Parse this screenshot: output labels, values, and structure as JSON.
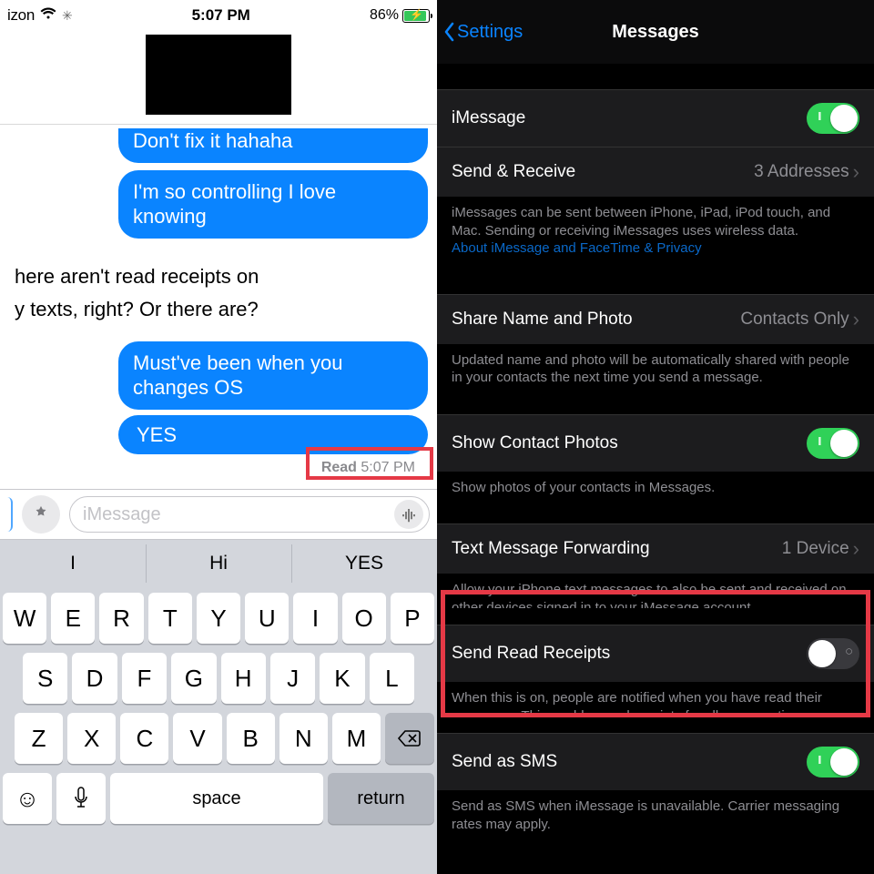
{
  "left": {
    "status": {
      "carrier": "izon",
      "time": "5:07 PM",
      "battery_pct": "86%"
    },
    "messages": {
      "cut_sent_top": "Don't fix it hahaha",
      "sent1": "I'm so controlling I love knowing",
      "recv_plain1": "here aren't read receipts on",
      "recv_plain2": "y texts, right? Or there are?",
      "sent2": "Must've been when you changes OS",
      "sent3": "YES",
      "read_label": "Read",
      "read_time": "5:07 PM"
    },
    "input": {
      "placeholder": "iMessage"
    },
    "suggestions": [
      "I",
      "Hi",
      "YES"
    ],
    "keyboard": {
      "row1": [
        "W",
        "E",
        "R",
        "T",
        "Y",
        "U",
        "I",
        "O",
        "P"
      ],
      "row2": [
        "S",
        "D",
        "F",
        "G",
        "H",
        "J",
        "K",
        "L"
      ],
      "row3": [
        "Z",
        "X",
        "C",
        "V",
        "B",
        "N",
        "M"
      ],
      "space": "space",
      "return": "return"
    }
  },
  "right": {
    "back": "Settings",
    "title": "Messages",
    "rows": {
      "imessage": {
        "label": "iMessage",
        "on": true
      },
      "send_receive": {
        "label": "Send & Receive",
        "detail": "3 Addresses"
      },
      "footer1a": "iMessages can be sent between iPhone, iPad, iPod touch, and Mac. Sending or receiving iMessages uses wireless data.",
      "footer1b": "About iMessage and FaceTime & Privacy",
      "share": {
        "label": "Share Name and Photo",
        "detail": "Contacts Only"
      },
      "footer2": "Updated name and photo will be automatically shared with people in your contacts the next time you send a message.",
      "contact_photos": {
        "label": "Show Contact Photos",
        "on": true
      },
      "footer3": "Show photos of your contacts in Messages.",
      "forwarding": {
        "label": "Text Message Forwarding",
        "detail": "1 Device"
      },
      "footer4": "Allow your iPhone text messages to also be sent and received on other devices signed in to your iMessage account.",
      "read_receipts": {
        "label": "Send Read Receipts",
        "on": false
      },
      "footer5": "When this is on, people are notified when you have read their messages. This enables read receipts for all conversations.",
      "send_sms": {
        "label": "Send as SMS",
        "on": true
      },
      "footer6": "Send as SMS when iMessage is unavailable. Carrier messaging rates may apply."
    }
  }
}
